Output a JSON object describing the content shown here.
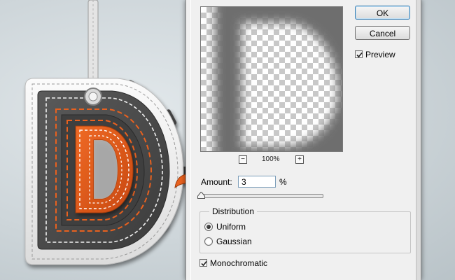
{
  "dialog": {
    "ok_label": "OK",
    "cancel_label": "Cancel",
    "preview_label": "Preview",
    "preview_checked": true,
    "zoom": "100%",
    "zoom_out_glyph": "−",
    "zoom_in_glyph": "+",
    "amount_label": "Amount:",
    "amount_value": "3",
    "amount_unit": "%",
    "distribution_label": "Distribution",
    "options": [
      {
        "label": "Uniform",
        "selected": true
      },
      {
        "label": "Gaussian",
        "selected": false
      }
    ],
    "monochromatic_label": "Monochromatic",
    "monochromatic_checked": true
  },
  "artwork": {
    "letter": "D",
    "colors": {
      "background": "#cfd7db",
      "tag_white": "#f2f2f2",
      "leather_dark": "#4a4a4a",
      "stitch_orange": "#e8611f",
      "letter_orange": "#e0561a",
      "arrow_orange": "#e8611f"
    }
  },
  "icons": {
    "pointer": "arrow-pointer-icon",
    "zoom_out": "zoom-out-icon",
    "zoom_in": "zoom-in-icon",
    "slider": "slider-thumb-icon"
  }
}
